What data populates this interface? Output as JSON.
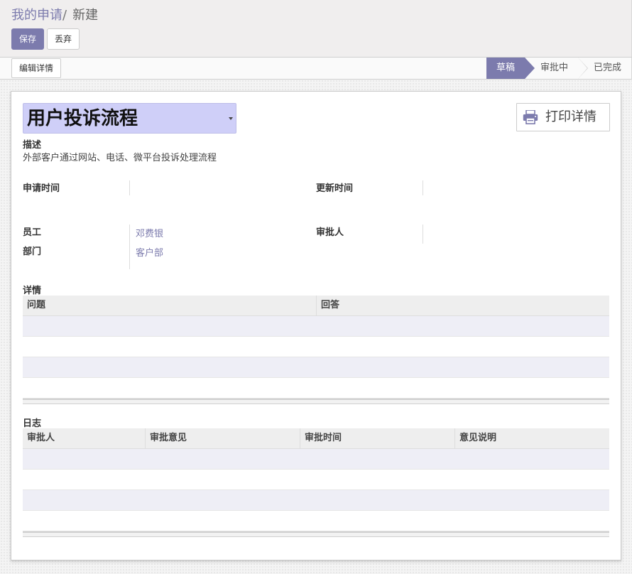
{
  "breadcrumb": {
    "parent": "我的申请",
    "separator": "/",
    "current": "新建"
  },
  "toolbar": {
    "save_label": "保存",
    "discard_label": "丢弃"
  },
  "statusbar": {
    "edit_detail_label": "编辑详情",
    "stages": [
      {
        "label": "草稿",
        "active": true
      },
      {
        "label": "审批中",
        "active": false
      },
      {
        "label": "已完成",
        "active": false
      }
    ]
  },
  "form": {
    "title": "用户投诉流程",
    "print_label": "打印详情",
    "description_label": "描述",
    "description_value": "外部客户通过网站、电话、微平台投诉处理流程",
    "apply_time_label": "申请时间",
    "apply_time_value": "",
    "update_time_label": "更新时间",
    "update_time_value": "",
    "employee_label": "员工",
    "employee_value": "邓费银",
    "department_label": "部门",
    "department_value": "客户部",
    "approver_label": "审批人",
    "approver_value": ""
  },
  "details": {
    "title": "详情",
    "columns": [
      "问题",
      "回答"
    ]
  },
  "log": {
    "title": "日志",
    "columns": [
      "审批人",
      "审批意见",
      "审批时间",
      "意见说明"
    ]
  },
  "colors": {
    "accent": "#7c7bad",
    "title_bg": "#cfcff8"
  },
  "icons": {
    "print": "printer-icon",
    "dropdown": "caret-down-icon"
  }
}
